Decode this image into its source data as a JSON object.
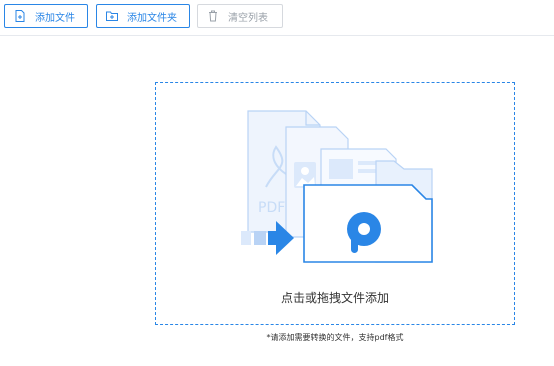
{
  "toolbar": {
    "add_file": {
      "label": "添加文件",
      "icon": "add-file-icon"
    },
    "add_folder": {
      "label": "添加文件夹",
      "icon": "add-folder-icon"
    },
    "clear_list": {
      "label": "清空列表",
      "icon": "trash-icon",
      "disabled": true
    }
  },
  "dropzone": {
    "text": "点击或拖拽文件添加",
    "illustration_label": "PDF",
    "illustration_logo": "P"
  },
  "hint": "*请添加需要转换的文件，支持pdf格式",
  "colors": {
    "accent": "#2a86e6",
    "illustration_light": "#dce9fb",
    "illustration_border": "#b9d3f5"
  }
}
